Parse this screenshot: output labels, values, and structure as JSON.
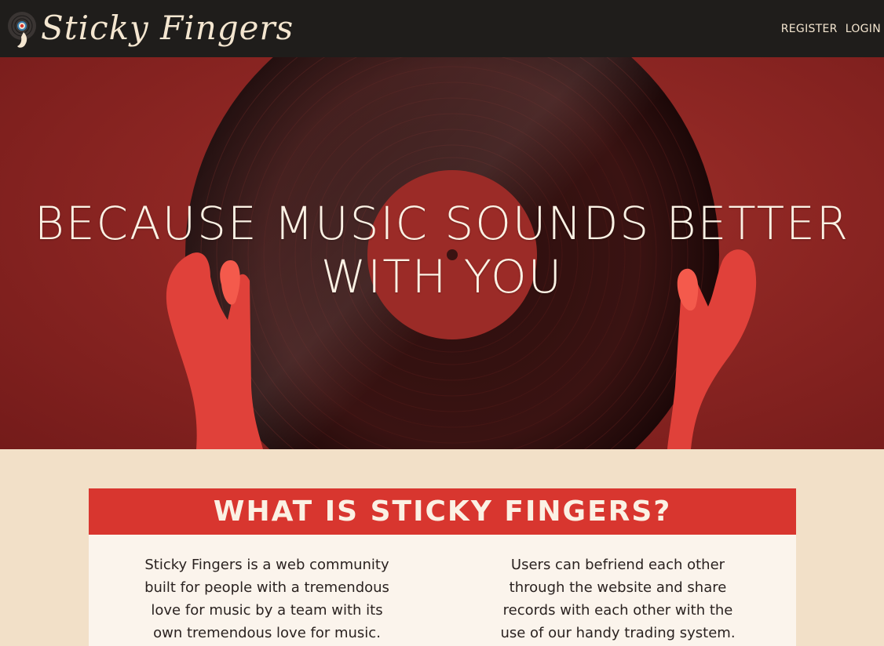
{
  "header": {
    "brand": "Sticky Fingers",
    "nav": {
      "register": "REGISTER",
      "login": "LOGIN"
    }
  },
  "hero": {
    "title_line1": "BECAUSE MUSIC SOUNDS BETTER",
    "title_line2": "WITH YOU"
  },
  "about": {
    "title": "WHAT IS STICKY FINGERS?",
    "col1": "Sticky Fingers is a web community built for people with a tremendous love for music by a team with its own tremendous love for music. Sticky",
    "col2": "Users can befriend each other through the website and share records with each other with the use of our handy trading system. Users"
  },
  "colors": {
    "header_bg": "#1f1d1b",
    "hero_red": "#8d2623",
    "accent": "#d8362f",
    "page_bg": "#f2e0c8",
    "card_bg": "#fbf4ec"
  },
  "icons": {
    "logo": "record-hand-icon"
  }
}
